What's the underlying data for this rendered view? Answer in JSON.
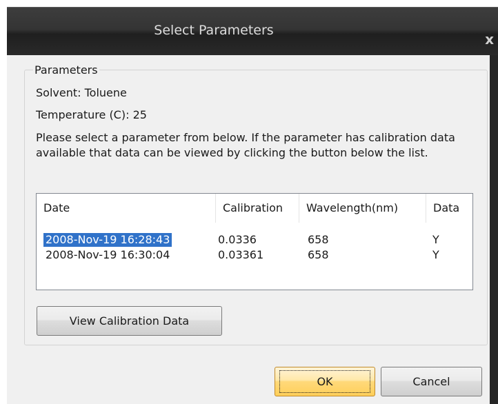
{
  "window": {
    "title": "Select Parameters",
    "close_glyph": "x"
  },
  "group": {
    "legend": "Parameters",
    "solvent": "Solvent: Toluene",
    "temperature": "Temperature (C): 25",
    "description": "Please select a parameter from below. If the parameter has calibration data available that data can be viewed by clicking the button below the list."
  },
  "table": {
    "headers": [
      "Date",
      "Calibration",
      "Wavelength(nm)",
      "Data"
    ],
    "rows": [
      [
        "2008-Nov-19 16:28:43",
        "0.0336",
        "658",
        "Y"
      ],
      [
        "2008-Nov-19 16:30:04",
        "0.03361",
        "658",
        "Y"
      ]
    ],
    "selected_row": 0
  },
  "buttons": {
    "view_calibration": "View Calibration Data",
    "ok": "OK",
    "cancel": "Cancel"
  },
  "colors": {
    "selection": "#3072c9",
    "title_bar": "#2e2e2e",
    "ok_button": "#ffd97a"
  }
}
